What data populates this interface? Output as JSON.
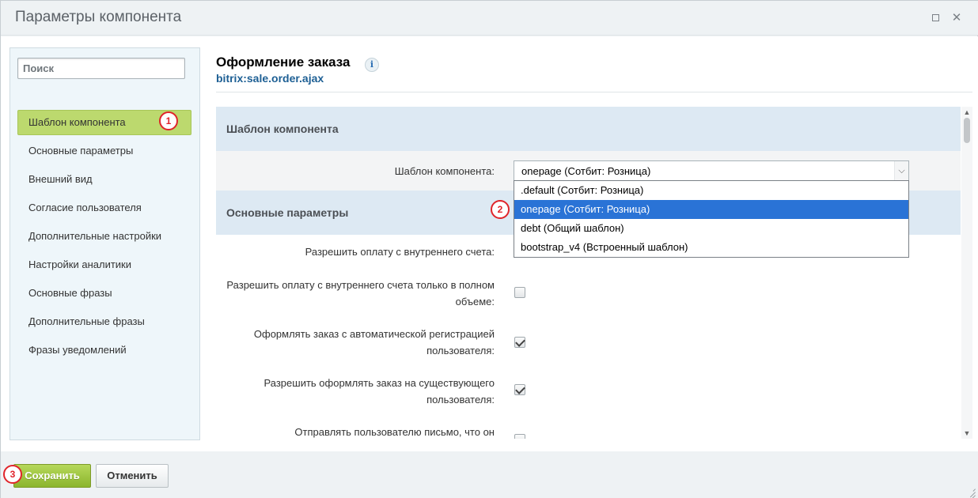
{
  "window": {
    "title": "Параметры компонента",
    "maximize_icon": "maximize-icon",
    "close_icon": "close-icon"
  },
  "sidebar": {
    "search_placeholder": "Поиск",
    "items": [
      {
        "label": "Шаблон компонента",
        "active": true
      },
      {
        "label": "Основные параметры"
      },
      {
        "label": "Внешний вид"
      },
      {
        "label": "Согласие пользователя"
      },
      {
        "label": "Дополнительные настройки"
      },
      {
        "label": "Настройки аналитики"
      },
      {
        "label": "Основные фразы"
      },
      {
        "label": "Дополнительные фразы"
      },
      {
        "label": "Фразы уведомлений"
      }
    ]
  },
  "component": {
    "title": "Оформление заказа",
    "info_icon": "i",
    "code": "bitrix:sale.order.ajax"
  },
  "sections": {
    "template": {
      "title": "Шаблон компонента",
      "field_label": "Шаблон компонента:",
      "selected_value": "onepage (Сотбит: Розница)",
      "options": [
        ".default (Сотбит: Розница)",
        "onepage (Сотбит: Розница)",
        "debt (Общий шаблон)",
        "bootstrap_v4 (Встроенный шаблон)"
      ]
    },
    "main": {
      "title": "Основные параметры",
      "params": [
        {
          "label": "Разрешить оплату с внутреннего счета:",
          "checked": false
        },
        {
          "label_line1": "Разрешить оплату с внутреннего счета только в полном",
          "label_line2": "объеме:",
          "checked": false
        },
        {
          "label_line1": "Оформлять заказ с автоматической регистрацией",
          "label_line2": "пользователя:",
          "checked": true
        },
        {
          "label_line1": "Разрешить оформлять заказ на существующего",
          "label_line2": "пользователя:",
          "checked": true
        },
        {
          "label_line1": "Отправлять пользователю письмо, что он",
          "checked": false
        }
      ]
    }
  },
  "footer": {
    "save_label": "Сохранить",
    "cancel_label": "Отменить"
  },
  "badges": [
    "1",
    "2",
    "3"
  ],
  "colors": {
    "active_nav": "#bcd96e",
    "section_header": "#dde9f3",
    "selected_option": "#2a73d6",
    "save_button": "#8bb52d",
    "badge": "#e0242a"
  }
}
